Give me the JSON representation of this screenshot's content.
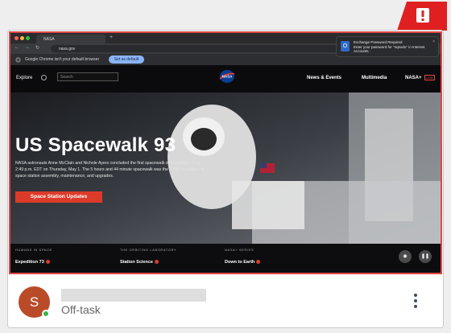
{
  "browser": {
    "tab_title": "NASA",
    "url": "nasa.gov",
    "default_browser_text": "Google Chrome isn't your default browser",
    "default_button": "Set as default"
  },
  "notification": {
    "title": "Exchange Password Required",
    "body": "Enter your password for \"nqsodo\" in Internet Accounts.",
    "icon": "outlook-icon"
  },
  "nasa_nav": {
    "explore": "Explore",
    "search_placeholder": "Search",
    "logo": "NASA",
    "menu": [
      "News & Events",
      "Multimedia",
      "NASA+"
    ],
    "live": "LIVE"
  },
  "hero": {
    "title": "US Spacewalk 93",
    "description": "NASA astronauts Anne McClain and Nichole Ayers concluded the first spacewalk of Expedition 73 at 2:49 p.m. EDT on Thursday, May 1. The 5 hours and 44 minute spacewalk was the 275th in support of space station assembly, maintenance, and upgrades.",
    "cta": "Space Station Updates"
  },
  "strip": [
    {
      "kicker": "HUMANS IN SPACE",
      "label": "Expedition 73"
    },
    {
      "kicker": "THE ORBITING LABORATORY",
      "label": "Station Science"
    },
    {
      "kicker": "NASA+ SERIES",
      "label": "Down to Earth"
    }
  ],
  "footer": {
    "avatar_initial": "S",
    "status": "Off-task"
  },
  "colors": {
    "alert": "#e02020",
    "border_alert": "#e04646",
    "avatar": "#b94b29",
    "online": "#3bb54a"
  }
}
